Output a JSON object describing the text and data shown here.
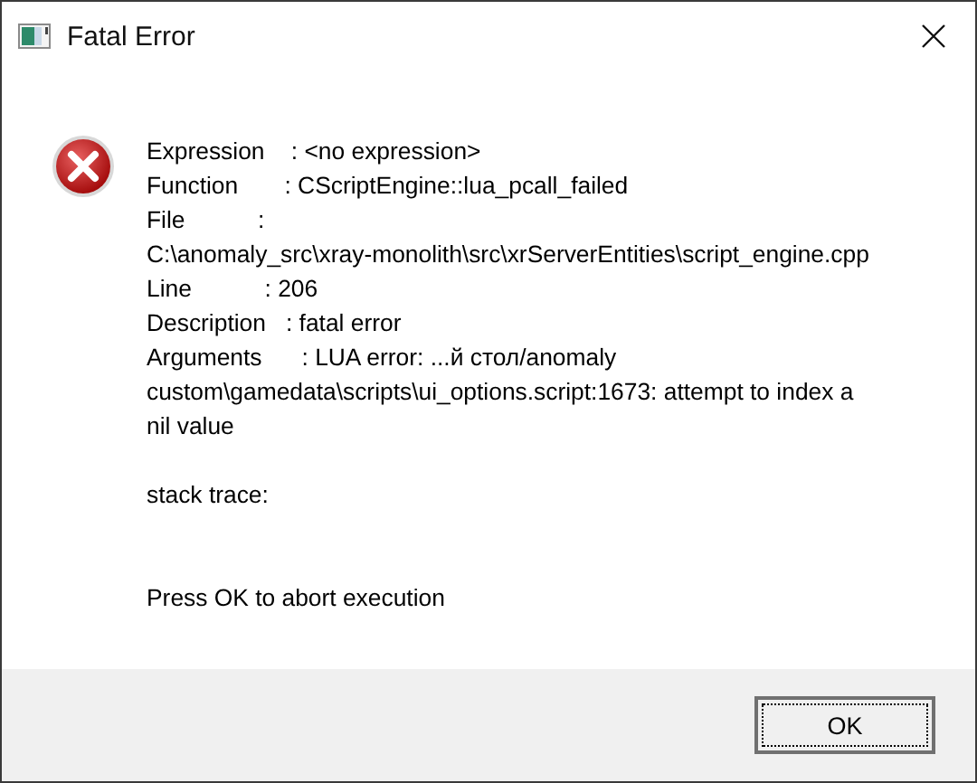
{
  "window": {
    "title": "Fatal Error"
  },
  "message": {
    "paragraphs": [
      {
        "kind": "details",
        "lines": [
          "Expression    : <no expression>",
          "Function       : CScriptEngine::lua_pcall_failed",
          "File           :",
          "C:\\anomaly_src\\xray-monolith\\src\\xrServerEntities\\script_engine.cpp",
          "Line           : 206",
          "Description   : fatal error",
          "Arguments      : LUA error: ...й стол/anomaly",
          "custom\\gamedata\\scripts\\ui_options.script:1673: attempt to index a",
          "nil value"
        ]
      },
      {
        "kind": "trace",
        "lines": [
          "stack trace:"
        ]
      },
      {
        "kind": "prompt",
        "lines": [
          "Press OK to abort execution"
        ]
      }
    ]
  },
  "buttons": [
    {
      "label": "OK",
      "focused": true
    }
  ]
}
